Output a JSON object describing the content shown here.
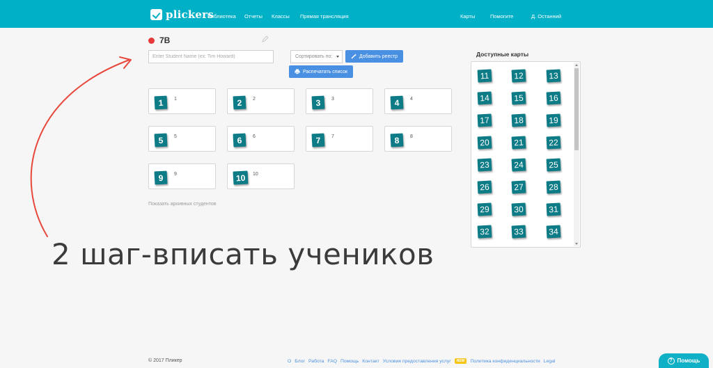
{
  "app": {
    "brand": "plickers"
  },
  "nav": {
    "library": "Библиотека",
    "reports": "Отчеты",
    "classes": "Классы",
    "live": "Прямая трансляция",
    "cards": "Карты",
    "help": "Помогите",
    "user": "Д. Останний"
  },
  "class": {
    "name": "7B",
    "status_color": "#e8393a"
  },
  "roster": {
    "student_input_placeholder": "Enter Student Name (ex: Tim Howard)",
    "sort_label": "Сортировать по:",
    "add_button": "Добавить реестр",
    "print_button": "Распечатать список",
    "show_archived": "Показать архивных студентов"
  },
  "students": [
    {
      "card": "1",
      "name": "1"
    },
    {
      "card": "2",
      "name": "2"
    },
    {
      "card": "3",
      "name": "3"
    },
    {
      "card": "4",
      "name": "4"
    },
    {
      "card": "5",
      "name": "5"
    },
    {
      "card": "6",
      "name": "6"
    },
    {
      "card": "7",
      "name": "7"
    },
    {
      "card": "8",
      "name": "8"
    },
    {
      "card": "9",
      "name": "9"
    },
    {
      "card": "10",
      "name": "10"
    }
  ],
  "available_cards": {
    "title": "Доступные карты",
    "numbers": [
      "11",
      "12",
      "13",
      "14",
      "15",
      "16",
      "17",
      "18",
      "19",
      "20",
      "21",
      "22",
      "23",
      "24",
      "25",
      "26",
      "27",
      "28",
      "29",
      "30",
      "31",
      "32",
      "33",
      "34"
    ]
  },
  "annotation": {
    "text": "2 шаг-вписать учеников",
    "arrow_color": "#e8483b"
  },
  "footer": {
    "copyright": "© 2017 Пликер",
    "links": [
      "О",
      "Блог",
      "Работа",
      "FAQ",
      "Помощь",
      "Контакт",
      "Условия предоставления услуг"
    ],
    "new_badge": "NEW",
    "privacy": "Политика конфиденциальности",
    "legal": "Legal"
  },
  "help_widget": {
    "label": "Помощь"
  },
  "colors": {
    "topbar": "#00b0c7",
    "card": "#0e7c87",
    "button": "#4a90e2"
  }
}
